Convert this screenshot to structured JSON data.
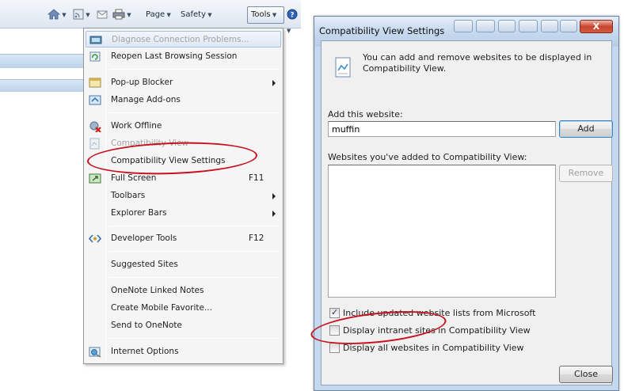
{
  "toolbar": {
    "page_label": "Page",
    "safety_label": "Safety",
    "tools_label": "Tools"
  },
  "tools_menu": {
    "items": [
      {
        "label": "Diagnose Connection Problems...",
        "icon": "network-diagnose-icon",
        "state": "disabled-highlighted"
      },
      {
        "label": "Reopen Last Browsing Session",
        "icon": "reopen-session-icon"
      },
      {
        "label": "Pop-up Blocker",
        "icon": "popup-blocker-icon",
        "submenu": true
      },
      {
        "label": "Manage Add-ons",
        "icon": "addons-icon"
      },
      {
        "label": "Work Offline",
        "icon": "work-offline-icon"
      },
      {
        "label": "Compatibility View",
        "icon": "compatibility-view-icon",
        "state": "disabled"
      },
      {
        "label": "Compatibility View Settings",
        "annotated": true
      },
      {
        "label": "Full Screen",
        "icon": "fullscreen-icon",
        "shortcut": "F11"
      },
      {
        "label": "Toolbars",
        "submenu": true
      },
      {
        "label": "Explorer Bars",
        "submenu": true
      },
      {
        "label": "Developer Tools",
        "icon": "developer-tools-icon",
        "shortcut": "F12"
      },
      {
        "label": "Suggested Sites"
      },
      {
        "label": "OneNote Linked Notes"
      },
      {
        "label": "Create Mobile Favorite..."
      },
      {
        "label": "Send to OneNote"
      },
      {
        "label": "Internet Options",
        "icon": "internet-options-icon"
      }
    ]
  },
  "dialog": {
    "title": "Compatibility View Settings",
    "info_text": "You can add and remove websites to be displayed in Compatibility View.",
    "add_label": "Add this website:",
    "add_value": "muffin",
    "add_button": "Add",
    "list_label": "Websites you've added to Compatibility View:",
    "remove_button": "Remove",
    "checkboxes": [
      {
        "label": "Include updated website lists from Microsoft",
        "checked": true
      },
      {
        "label": "Display intranet sites in Compatibility View",
        "checked": false,
        "annotated": true
      },
      {
        "label": "Display all websites in Compatibility View",
        "checked": false
      }
    ],
    "close_button": "Close",
    "close_x": "X"
  },
  "colors": {
    "annotation_red": "#c8101e",
    "title_bar": "#c9dbef",
    "menu_bg": "#f5f5f5"
  }
}
